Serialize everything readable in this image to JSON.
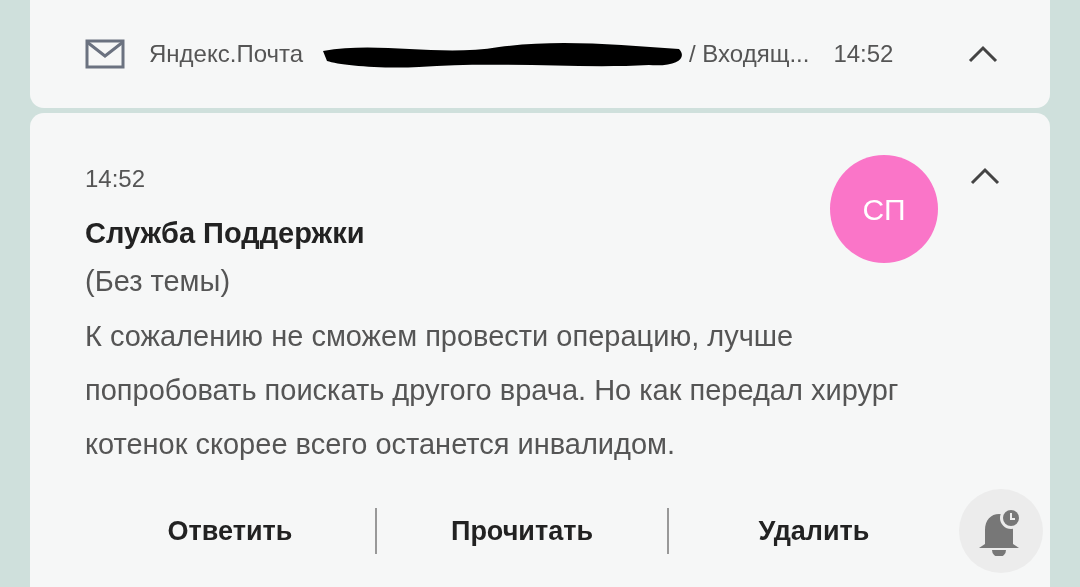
{
  "header": {
    "app_name": "Яндекс.Почта",
    "folder": "/ Входящ...",
    "time": "14:52"
  },
  "notification": {
    "time": "14:52",
    "sender": "Служба Поддержки",
    "avatar_initials": "СП",
    "subject": "(Без темы)",
    "body": "К сожалению не сможем провести операцию, лучше попробовать поискать другого врача. Но как передал хирург котенок скорее всего останется инвалидом.",
    "actions": [
      "Ответить",
      "Прочитать",
      "Удалить"
    ]
  }
}
